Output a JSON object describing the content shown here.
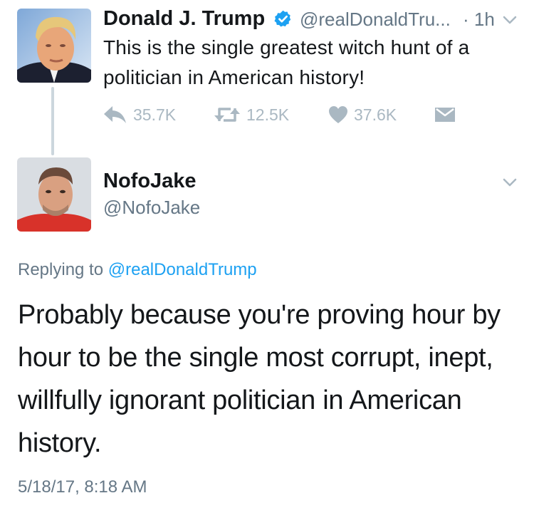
{
  "original_tweet": {
    "display_name": "Donald J. Trump",
    "handle": "@realDonaldTru...",
    "time_ago": "· 1h",
    "text": "This is the single greatest witch hunt of a politician in American history!",
    "actions": {
      "reply_count": "35.7K",
      "retweet_count": "12.5K",
      "like_count": "37.6K"
    }
  },
  "reply_tweet": {
    "display_name": "NofoJake",
    "handle": "@NofoJake",
    "replying_prefix": "Replying to",
    "replying_to": "@realDonaldTrump",
    "text": "Probably because you're proving hour by hour to be the single most corrupt, inept, willfully ignorant politician in American history.",
    "timestamp": "5/18/17, 8:18 AM"
  },
  "colors": {
    "muted": "#657786",
    "icon": "#aab8c2",
    "link": "#1da1f2",
    "verified": "#1da1f2",
    "thread_line": "#ccd6dd"
  },
  "icons": [
    "verified-badge-icon",
    "chevron-down-icon",
    "reply-icon",
    "retweet-icon",
    "heart-icon",
    "direct-message-icon"
  ]
}
